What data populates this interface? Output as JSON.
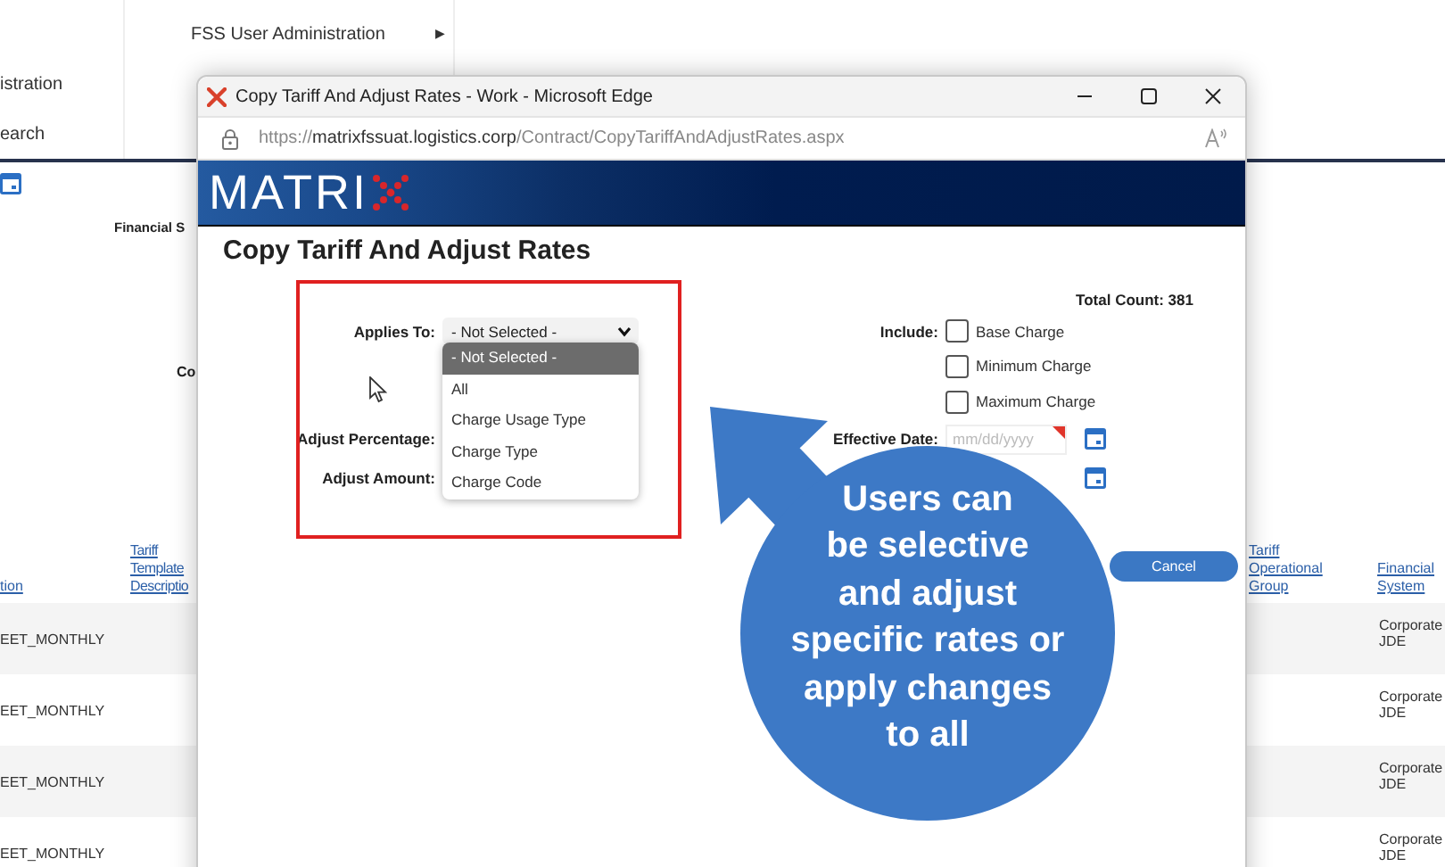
{
  "background_page": {
    "menu_column_1": [
      "istration",
      "earch"
    ],
    "menu_column_2": [
      {
        "label": "FSS User Administration",
        "submenu_arrow": "▶"
      }
    ],
    "filter_labels": [
      "Financial S",
      "Co"
    ],
    "table": {
      "columns": [
        "tion",
        "Tariff Template Descriptio",
        "Tariff Operational Group",
        "Financial System"
      ],
      "rows": [
        {
          "column_1": "EET_MONTHLY",
          "financial_system": "Corporate JDE"
        },
        {
          "column_1": "EET_MONTHLY",
          "financial_system": "Corporate JDE"
        },
        {
          "column_1": "EET_MONTHLY",
          "financial_system": "Corporate JDE"
        },
        {
          "column_1": "EET_MONTHLY",
          "financial_system": "Corporate JDE"
        }
      ]
    }
  },
  "browser_window": {
    "title": "Copy Tariff And Adjust Rates - Work - Microsoft Edge",
    "url": "https://**matrixfssuat.logistics.corp**/Contract/CopyTariffAndAdjustRates.aspx",
    "logo": "MATRI"
  },
  "form": {
    "heading": "Copy Tariff And Adjust Rates",
    "total_count": "Total Count: 381",
    "applies_to": {
      "label": "Applies To:",
      "value": "- Not Selected -",
      "expanded": true,
      "options": [
        {
          "label": "- Not Selected -",
          "selected": true
        },
        {
          "label": "All",
          "selected": false
        },
        {
          "label": "Charge Usage Type",
          "selected": false
        },
        {
          "label": "Charge Type",
          "selected": false
        },
        {
          "label": "Charge Code",
          "selected": false
        }
      ]
    },
    "adjust_percentage_label": "Adjust Percentage:",
    "adjust_amount_label": "Adjust Amount:",
    "include": {
      "label": "Include:",
      "options": [
        {
          "label": "Base Charge",
          "checked": false
        },
        {
          "label": "Minimum Charge",
          "checked": false
        },
        {
          "label": "Maximum Charge",
          "checked": false
        }
      ]
    },
    "effective_date": {
      "label": "Effective Date:",
      "placeholder": "mm/dd/yyyy",
      "required": true
    },
    "buttons": [
      "Cancel"
    ]
  },
  "callout": {
    "lines": [
      "Users can",
      "be selective",
      "and adjust",
      "specific rates or",
      "apply changes",
      "to all"
    ]
  }
}
